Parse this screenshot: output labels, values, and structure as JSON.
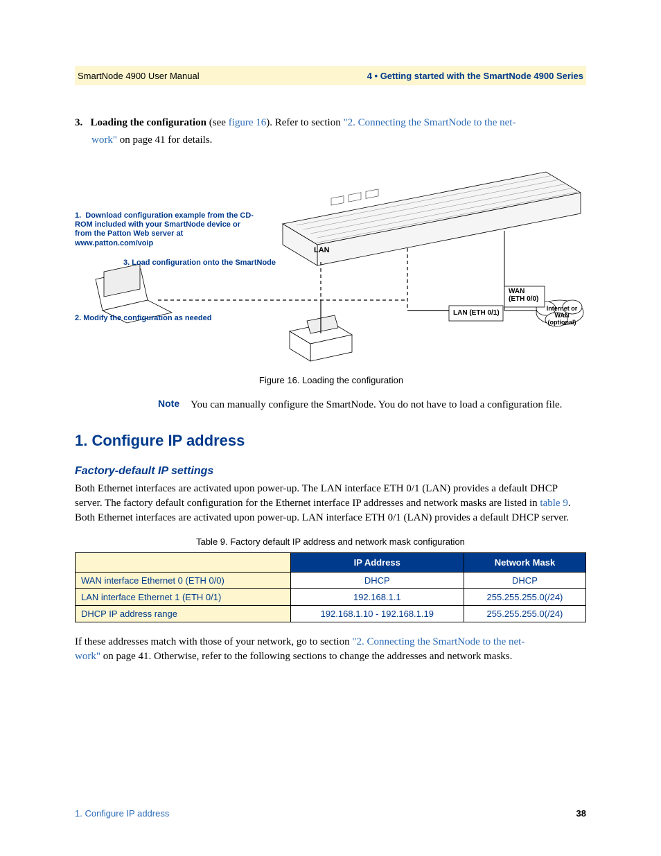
{
  "header": {
    "left": "SmartNode 4900 User Manual",
    "right": "4 • Getting started with the SmartNode 4900 Series"
  },
  "step": {
    "num": "3.",
    "bold": "Loading the configuration",
    "after_bold": " (see ",
    "fig_link": "figure 16",
    "after_fig": "). Refer to section ",
    "sec_link": "\"2. Connecting the SmartNode to the net-",
    "cont_link": "work\"",
    "cont_tail": " on page 41 for details."
  },
  "figure": {
    "caption": "Figure 16. Loading the configuration",
    "labels": {
      "dl1": "1.",
      "dl_text": "Download configuration example from the CD-ROM included with your SmartNode device or from the Patton Web server at www.patton.com/voip",
      "load": "3. Load configuration onto the SmartNode",
      "modify": "2. Modify the configuration as needed",
      "lan": "LAN",
      "lan_eth": "LAN (ETH 0/1)",
      "wan": "WAN",
      "wan_eth": "(ETH 0/0)",
      "inet1": "Internet or",
      "inet2": "WAN (optional)"
    }
  },
  "note": {
    "label": "Note",
    "text": "You can manually configure the SmartNode. You do not have to load a configuration file."
  },
  "section": {
    "h2": "1. Configure IP address",
    "h3": "Factory-default IP settings",
    "p1a": "Both Ethernet interfaces are activated upon power-up. The LAN interface ETH 0/1 (LAN) provides a default DHCP server. The factory default configuration for the Ethernet interface IP addresses and network masks are listed in ",
    "p1_link": "table 9",
    "p1b": ". Both Ethernet interfaces are activated upon power-up. LAN interface ETH 0/1 (LAN) provides a default DHCP server."
  },
  "table": {
    "caption": "Table 9. Factory default IP address and network mask configuration",
    "headers": {
      "ip": "IP Address",
      "mask": "Network Mask"
    },
    "rows": [
      {
        "label": "WAN interface Ethernet 0 (ETH 0/0)",
        "ip": "DHCP",
        "mask": "DHCP"
      },
      {
        "label": "LAN interface Ethernet 1 (ETH 0/1)",
        "ip": "192.168.1.1",
        "mask": "255.255.255.0(/24)"
      },
      {
        "label": "DHCP IP address range",
        "ip": "192.168.1.10 - 192.168.1.19",
        "mask": "255.255.255.0(/24)"
      }
    ]
  },
  "p2": {
    "a": "If these addresses match with those of your network, go to section ",
    "link1": "\"2. Connecting the SmartNode to the net-",
    "link2": "work\"",
    "b": " on page 41. Otherwise, refer to the following sections to change the addresses and network masks."
  },
  "footer": {
    "left": "1. Configure IP address",
    "right": "38"
  }
}
